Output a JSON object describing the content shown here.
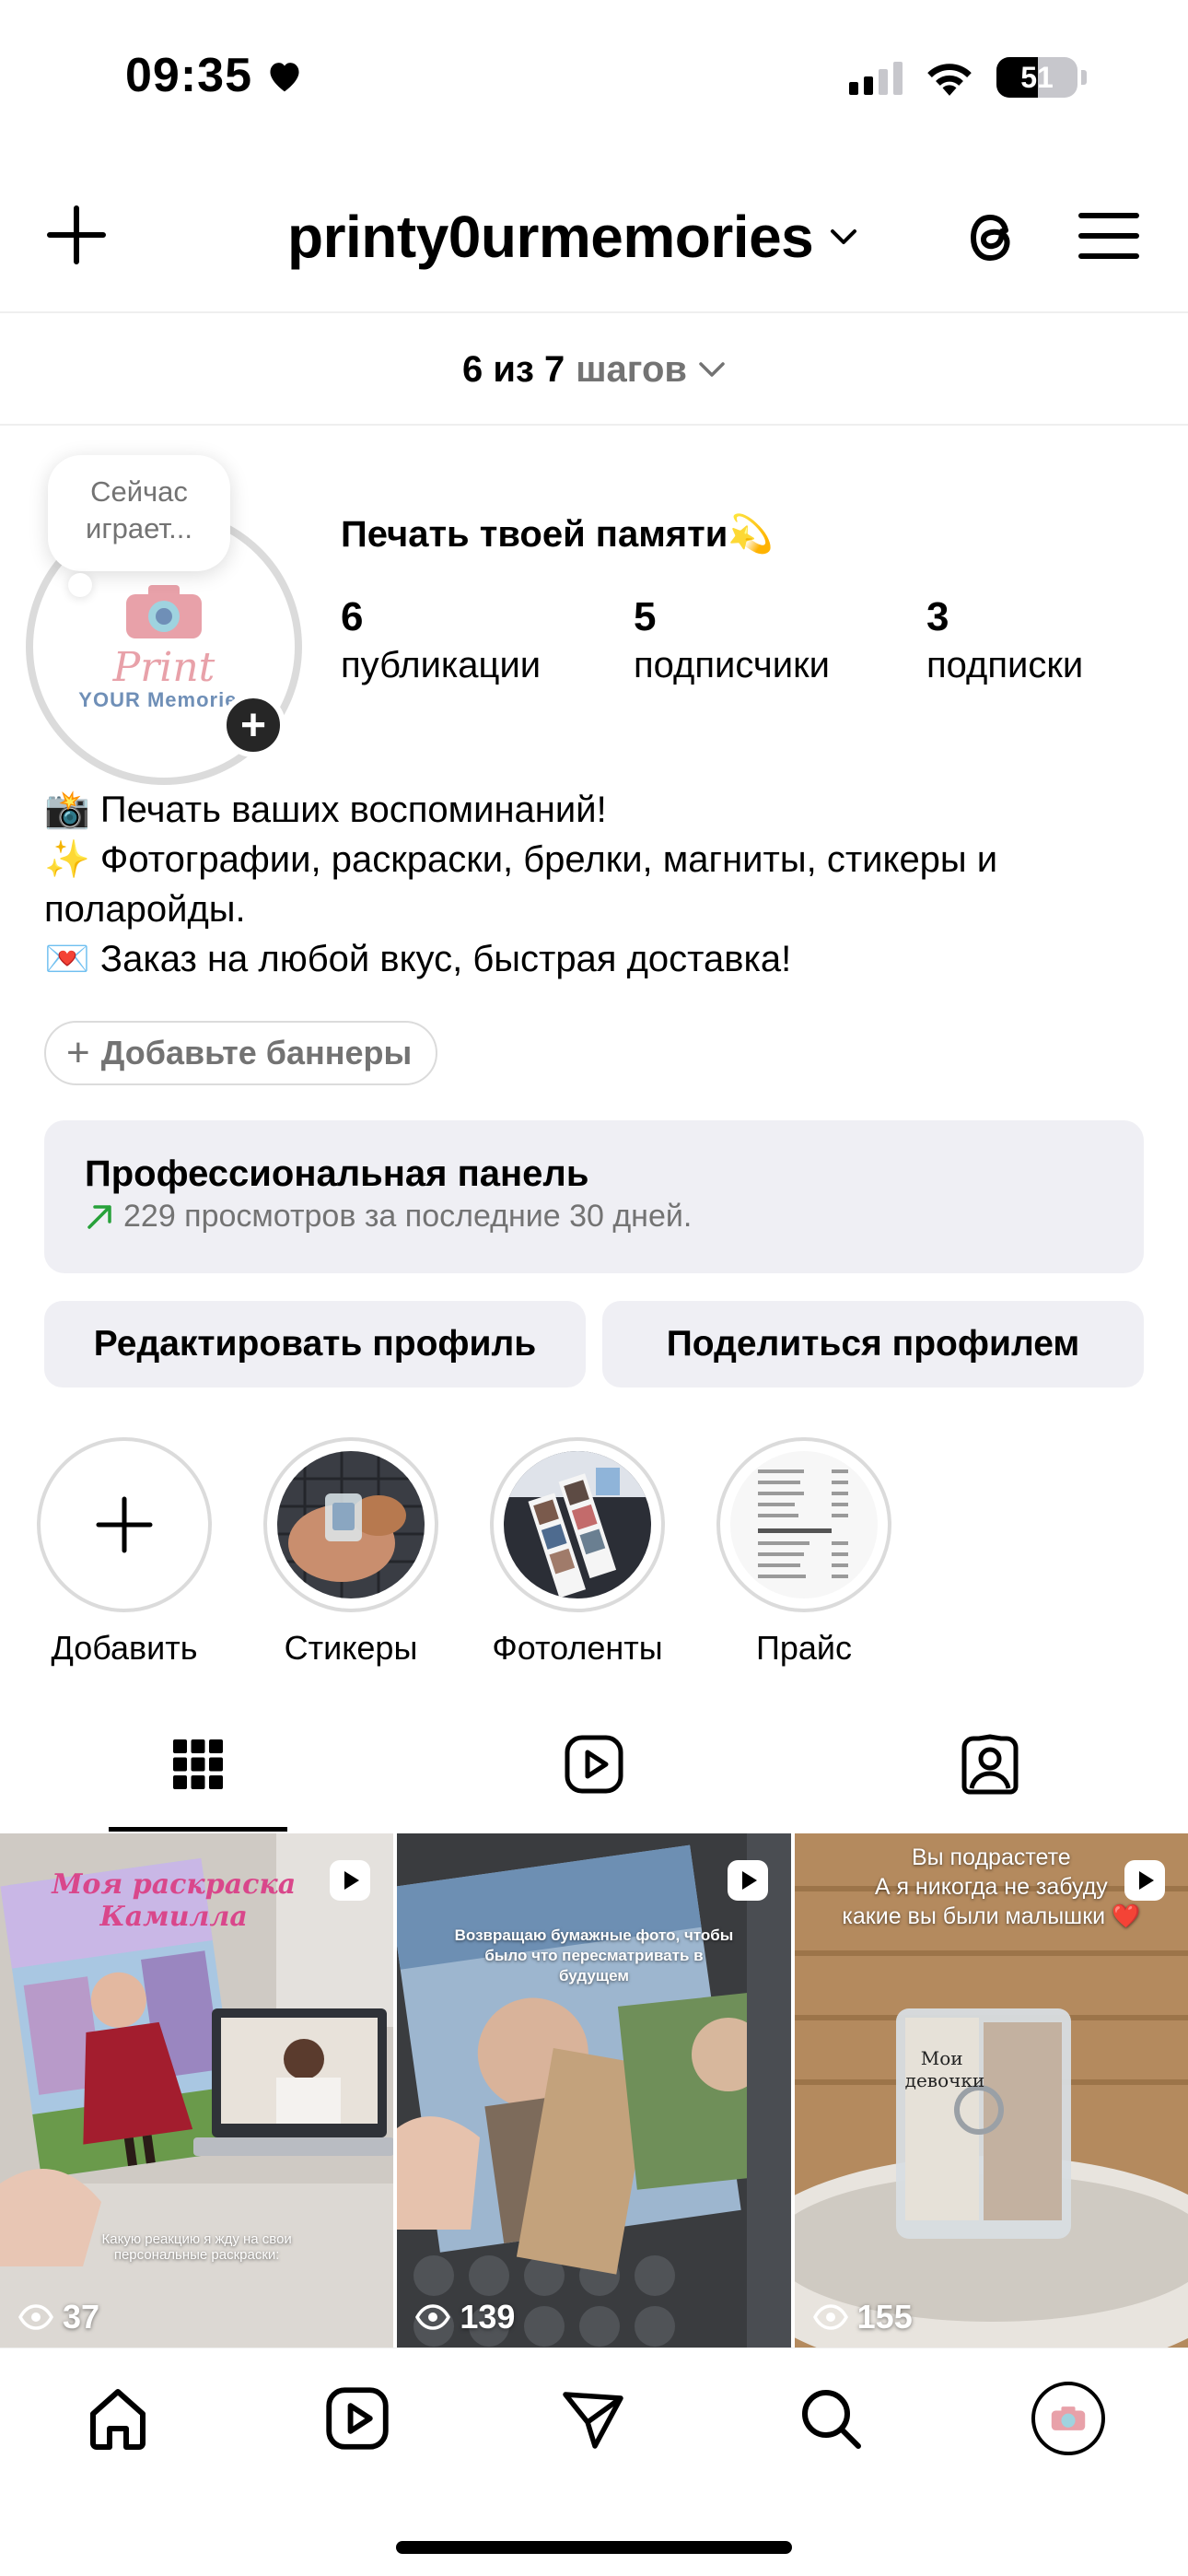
{
  "status_bar": {
    "time": "09:35",
    "battery": "51",
    "battery_level": 0.51
  },
  "header": {
    "username": "printy0urmemories"
  },
  "steps": {
    "count": "6 из 7",
    "label": "шагов"
  },
  "profile": {
    "note": "Сейчас играет...",
    "avatar_logo_script": "Print",
    "avatar_logo_sub": "YOUR Memories",
    "display_name": "Печать твоей памяти💫",
    "stats": [
      {
        "value": "6",
        "label": "публикации"
      },
      {
        "value": "5",
        "label": "подписчики"
      },
      {
        "value": "3",
        "label": "подписки"
      }
    ],
    "bio": [
      "📸 Печать ваших воспоминаний!",
      "✨ Фотографии, раскраски, брелки, магниты, стикеры и поларойды.",
      "💌 Заказ на любой вкус, быстрая доставка!"
    ],
    "add_banners": "Добавьте баннеры"
  },
  "pro_panel": {
    "title": "Профессиональная панель",
    "subtitle": "229 просмотров за последние 30 дней."
  },
  "buttons": {
    "edit": "Редактировать профиль",
    "share": "Поделиться профилем"
  },
  "highlights": [
    {
      "label": "Добавить",
      "type": "add"
    },
    {
      "label": "Стикеры"
    },
    {
      "label": "Фотоленты"
    },
    {
      "label": "Прайс"
    }
  ],
  "tabs": [
    "grid-icon",
    "reels-icon",
    "tagged-icon"
  ],
  "posts": [
    {
      "views": "37",
      "caption_top": "Моя раскраска Камилла",
      "caption_bottom": "Какую реакцию я жду на свои персональные раскраски:"
    },
    {
      "views": "139",
      "caption_top": "Возвращаю бумажные фото, чтобы было что пересматривать в будущем"
    },
    {
      "views": "155",
      "caption_top": "Вы подрастете\nА я никогда не забуду\nкакие вы были малышки ❤️",
      "caption_object": "Мои девочки"
    }
  ],
  "colors": {
    "accent_green": "#27a13a",
    "muted": "#737373",
    "panel": "#efeff4"
  }
}
